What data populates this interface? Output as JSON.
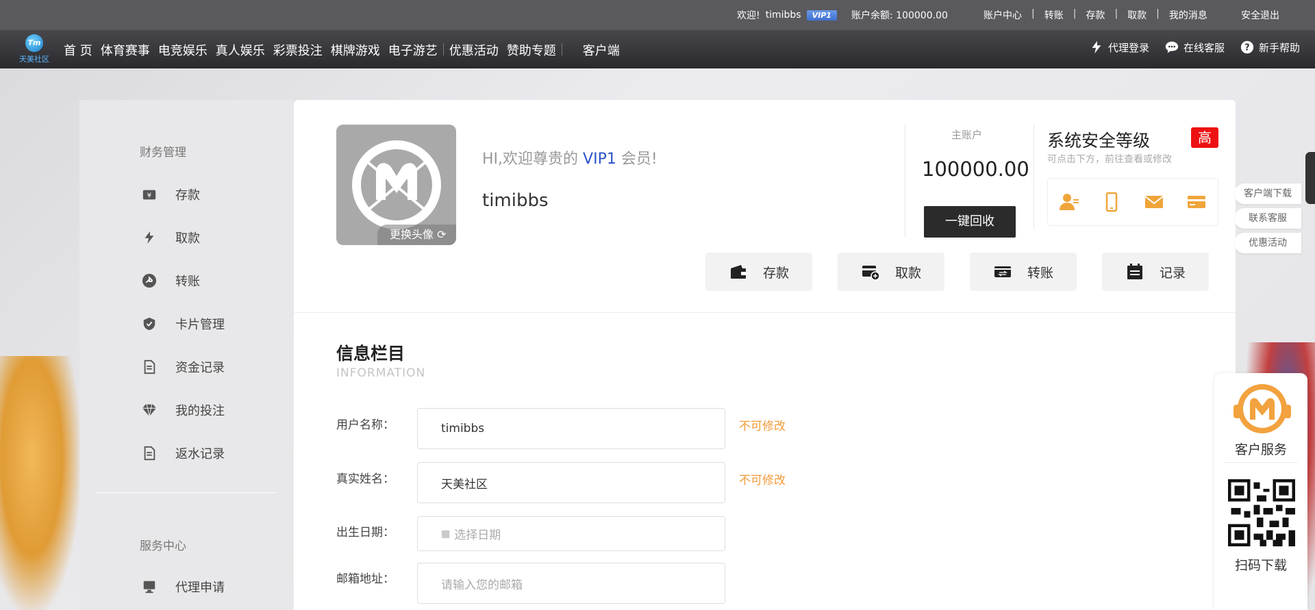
{
  "topbar": {
    "welcome": "欢迎!",
    "username": "timibbs",
    "vip": "VIP1",
    "balance_label": "账户余额:",
    "balance": "100000.00",
    "links": [
      "账户中心",
      "转账",
      "存款",
      "取款",
      "我的消息"
    ],
    "separator": "|",
    "logout": "安全退出"
  },
  "nav": {
    "logo_mark": "Tm",
    "logo_text": "天美社区",
    "items": [
      "首 页",
      "体育赛事",
      "电竞娱乐",
      "真人娱乐",
      "彩票投注",
      "棋牌游戏",
      "电子游艺",
      "优惠活动",
      "赞助专题",
      "客户端"
    ],
    "right": [
      "代理登录",
      "在线客服",
      "新手帮助"
    ]
  },
  "sidebar": {
    "group1": "财务管理",
    "items": [
      "存款",
      "取款",
      "转账",
      "卡片管理",
      "资金记录",
      "我的投注",
      "返水记录"
    ],
    "group2": "服务中心",
    "items2": [
      "代理申请"
    ]
  },
  "profile": {
    "avatar_change": "更换头像",
    "greet_pre": "HI,欢迎尊贵的 ",
    "greet_vip": "VIP1",
    "greet_post": " 会员!",
    "username": "timibbs",
    "account_label": "主账户",
    "account_amount": "100000.00",
    "recall_button": "一键回收",
    "security_title": "系统安全等级",
    "security_level": "高",
    "security_sub": "可点击下方，前往查看或修改"
  },
  "actions": [
    "存款",
    "取款",
    "转账",
    "记录"
  ],
  "info": {
    "title": "信息栏目",
    "subtitle": "INFORMATION",
    "fields": [
      {
        "label": "用户名称：",
        "value": "timibbs",
        "note": "不可修改"
      },
      {
        "label": "真实姓名：",
        "value": "天美社区",
        "note": "不可修改"
      },
      {
        "label": "出生日期：",
        "placeholder": "选择日期"
      },
      {
        "label": "邮箱地址：",
        "placeholder": "请输入您的邮箱"
      }
    ]
  },
  "side_tabs": [
    "客户端下载",
    "联系客服",
    "优惠活动"
  ],
  "service": {
    "title": "客户服务",
    "qr_title": "扫码下载"
  },
  "colors": {
    "accent_orange": "#f29a3a",
    "vip_blue": "#2b52c9",
    "level_red": "#ee1111"
  }
}
